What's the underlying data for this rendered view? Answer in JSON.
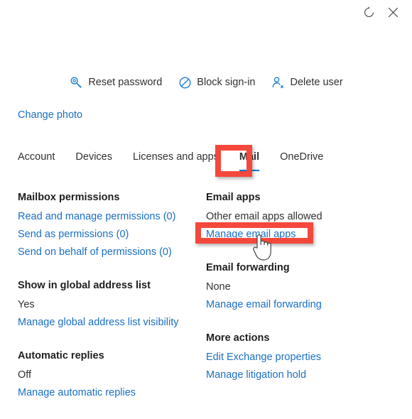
{
  "window": {
    "refresh_icon": "refresh-icon",
    "close_icon": "close-icon"
  },
  "command_bar": {
    "items": [
      {
        "icon": "key-icon",
        "label": "Reset password"
      },
      {
        "icon": "block-icon",
        "label": "Block sign-in"
      },
      {
        "icon": "delete-user-icon",
        "label": "Delete user"
      }
    ]
  },
  "profile": {
    "change_photo_label": "Change photo"
  },
  "tabs": {
    "items": [
      {
        "label": "Account",
        "active": false
      },
      {
        "label": "Devices",
        "active": false
      },
      {
        "label": "Licenses and apps",
        "active": false
      },
      {
        "label": "Mail",
        "active": true
      },
      {
        "label": "OneDrive",
        "active": false
      }
    ],
    "active_label": "Mail"
  },
  "left_column": {
    "sections": [
      {
        "title": "Mailbox permissions",
        "links": [
          "Read and manage permissions (0)",
          "Send as permissions (0)",
          "Send on behalf of permissions (0)"
        ]
      },
      {
        "title": "Show in global address list",
        "value": "Yes",
        "links": [
          "Manage global address list visibility"
        ]
      },
      {
        "title": "Automatic replies",
        "value": "Off",
        "links": [
          "Manage automatic replies"
        ]
      }
    ]
  },
  "right_column": {
    "sections": [
      {
        "title": "Email apps",
        "value": "Other email apps allowed",
        "links": [
          "Manage email apps"
        ]
      },
      {
        "title": "Email forwarding",
        "value": "None",
        "links": [
          "Manage email forwarding"
        ]
      },
      {
        "title": "More actions",
        "links": [
          "Edit Exchange properties",
          "Manage litigation hold"
        ]
      }
    ]
  },
  "annotations": {
    "color": "#f4483c",
    "targets": [
      "Mail",
      "Manage email apps"
    ]
  },
  "colors": {
    "link": "#1a6fc4",
    "accent": "#0078d4",
    "text": "#323130",
    "annotation_red": "#f4483c"
  }
}
